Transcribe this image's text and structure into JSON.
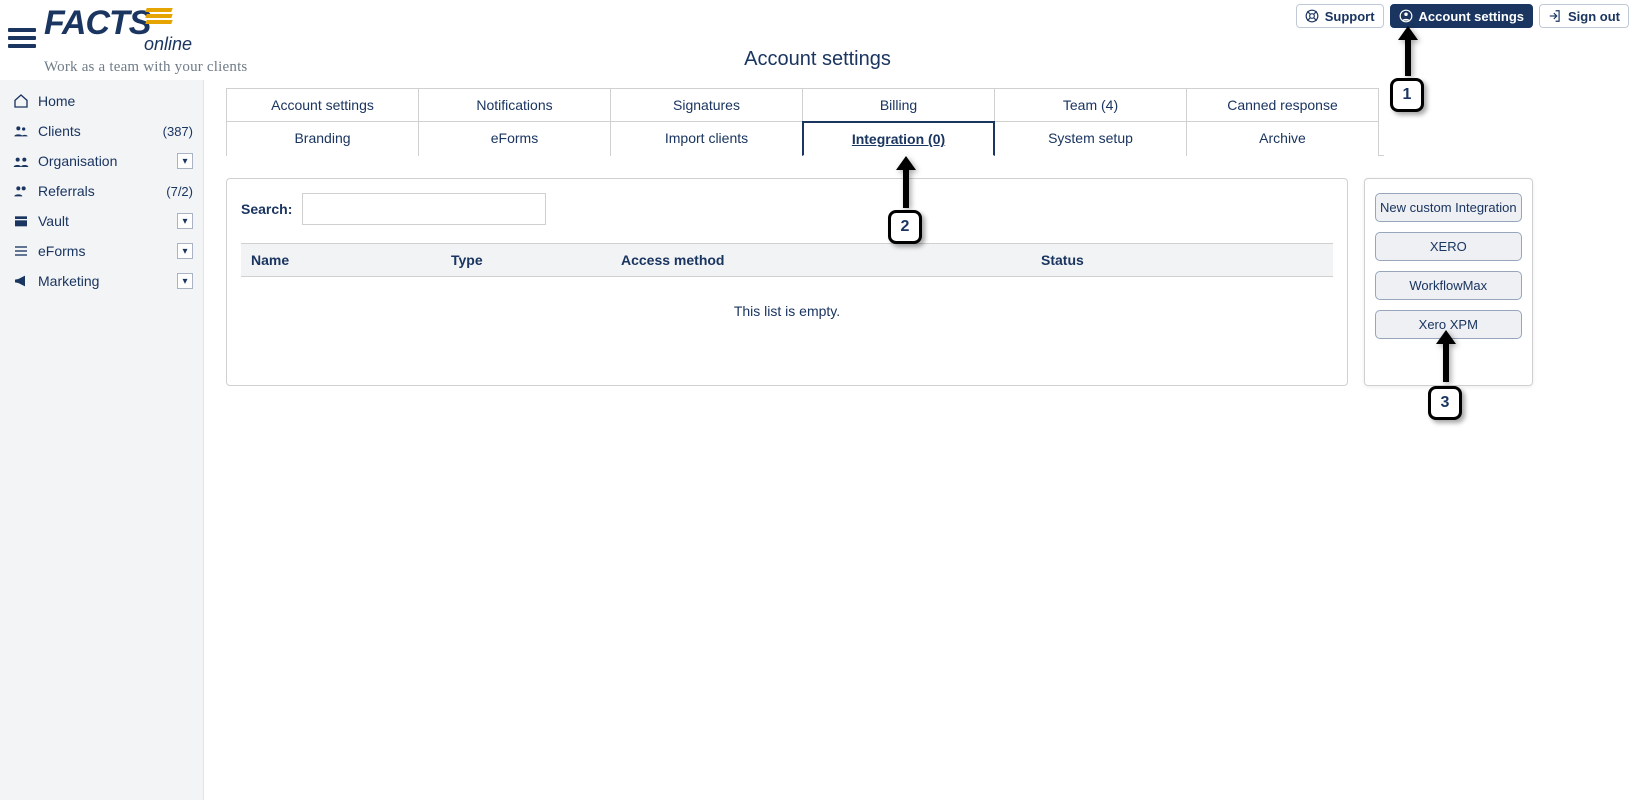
{
  "header": {
    "logo_main": "FACTS",
    "logo_sub": "online",
    "tagline": "Work as a team with your clients",
    "page_title": "Account settings",
    "support": "Support",
    "account_settings": "Account settings",
    "sign_out": "Sign out"
  },
  "sidebar": {
    "items": [
      {
        "icon": "home",
        "label": "Home",
        "count": "",
        "caret": false
      },
      {
        "icon": "users",
        "label": "Clients",
        "count": "(387)",
        "caret": false
      },
      {
        "icon": "org",
        "label": "Organisation",
        "count": "",
        "caret": true
      },
      {
        "icon": "people",
        "label": "Referrals",
        "count": "(7/2)",
        "caret": false
      },
      {
        "icon": "vault",
        "label": "Vault",
        "count": "",
        "caret": true
      },
      {
        "icon": "list",
        "label": "eForms",
        "count": "",
        "caret": true
      },
      {
        "icon": "bullhorn",
        "label": "Marketing",
        "count": "",
        "caret": true
      }
    ]
  },
  "tabs_row1": [
    "Account settings",
    "Notifications",
    "Signatures",
    "Billing",
    "Team (4)",
    "Canned response"
  ],
  "tabs_row2": [
    "Branding",
    "eForms",
    "Import clients",
    "Integration (0)",
    "System setup",
    "Archive"
  ],
  "active_tab": "Integration (0)",
  "panel": {
    "search_label": "Search:",
    "search_value": "",
    "columns": [
      "Name",
      "Type",
      "Access method",
      "Status"
    ],
    "empty": "This list is empty."
  },
  "side_buttons": [
    "New custom Integration",
    "XERO",
    "WorkflowMax",
    "Xero XPM"
  ],
  "annotations": {
    "a1": "1",
    "a2": "2",
    "a3": "3"
  }
}
